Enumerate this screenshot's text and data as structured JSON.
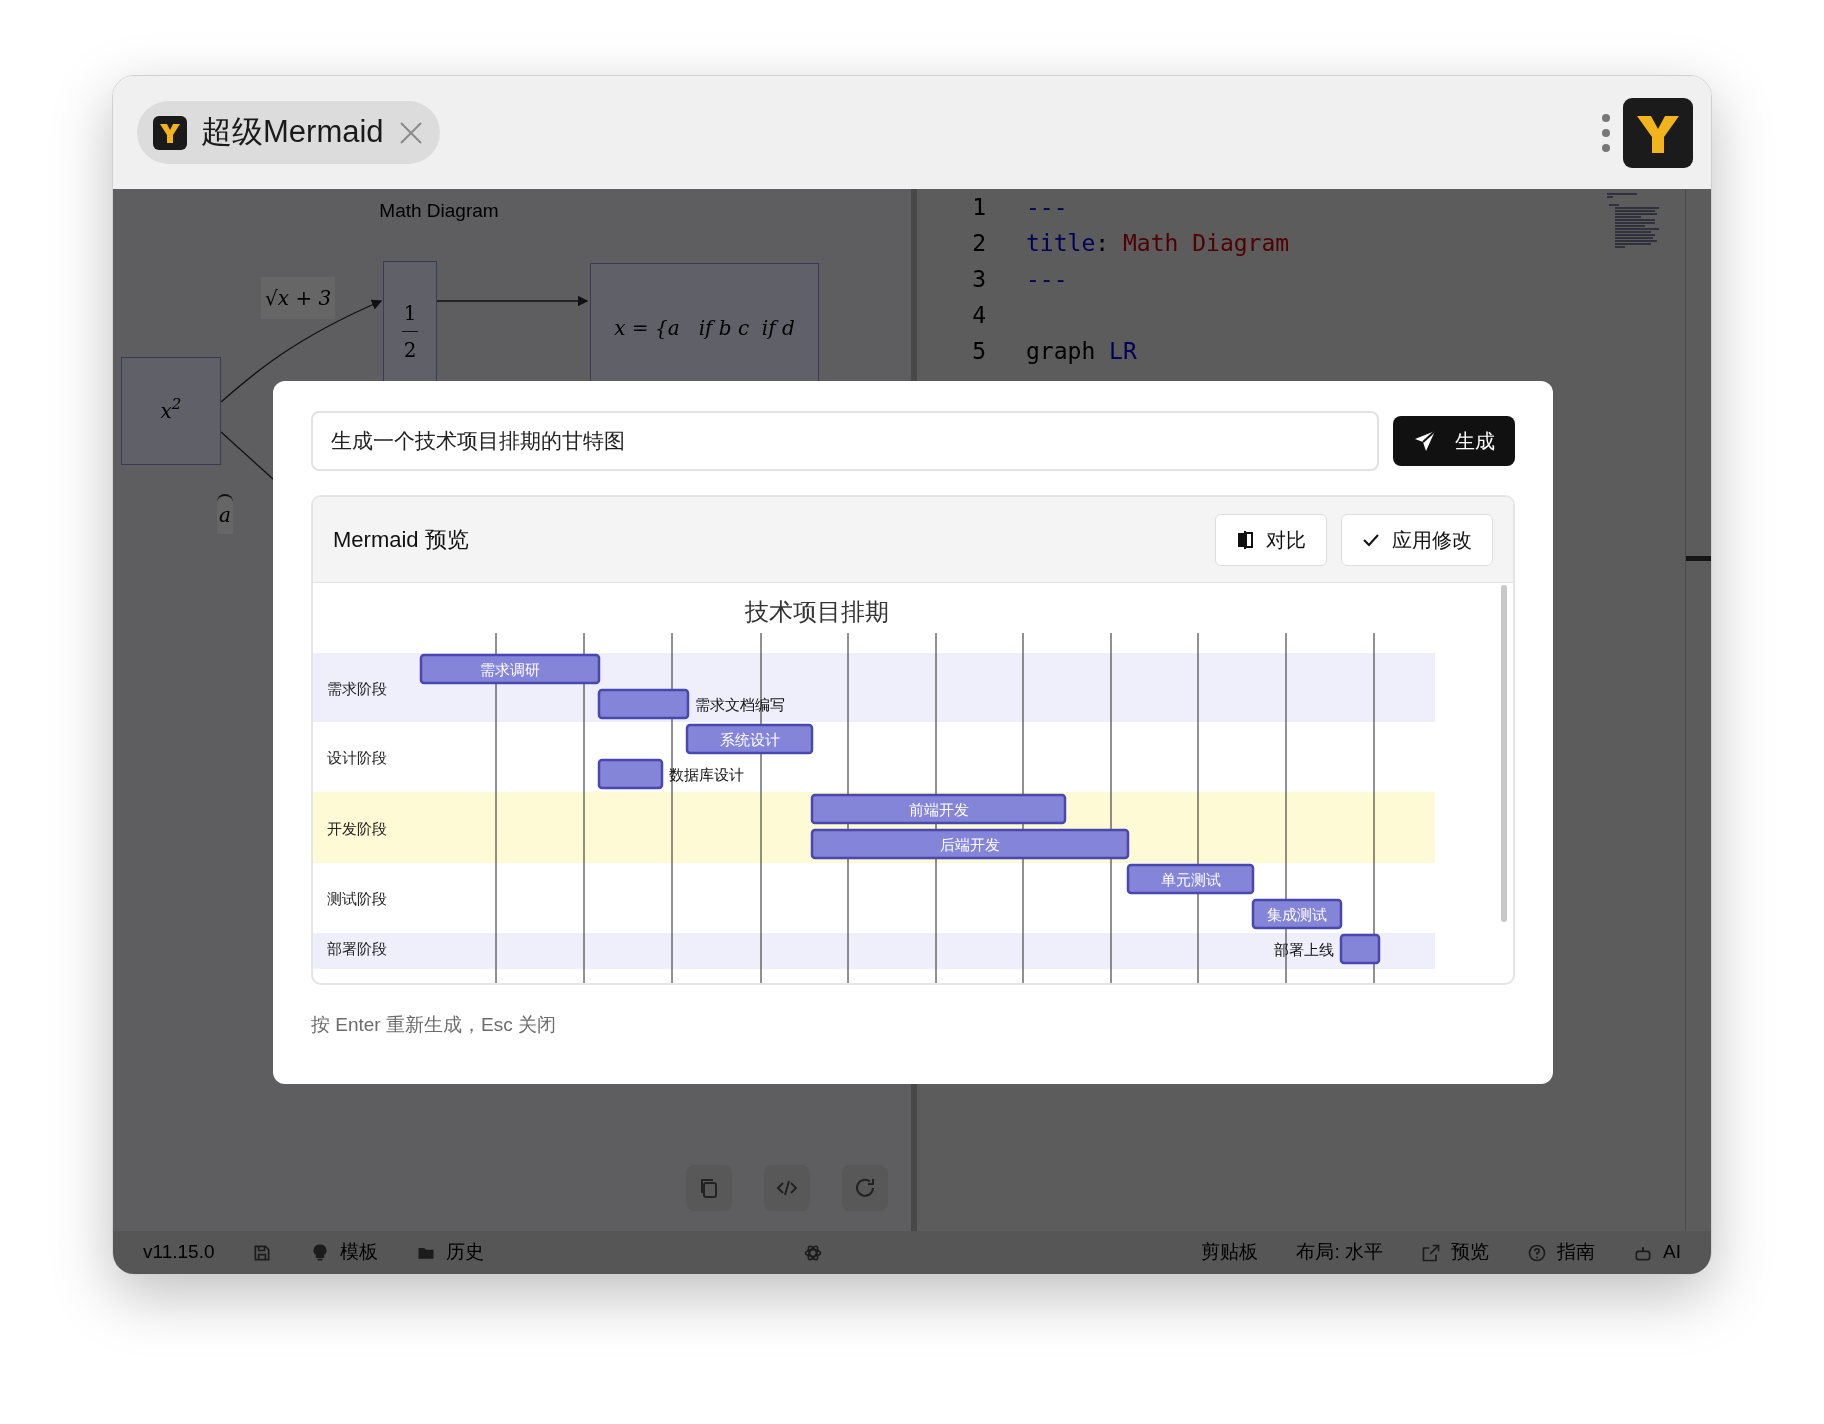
{
  "window": {
    "tab": {
      "title": "超级Mermaid"
    }
  },
  "preview": {
    "diagram_title": "Math Diagram",
    "nodes": [
      {
        "kind": "power",
        "text": "x$^{2}$"
      },
      {
        "kind": "fraction",
        "numerator": "1",
        "denominator": "2"
      },
      {
        "kind": "cases",
        "text": "x = {a   if b c  if d"
      }
    ],
    "edge_labels": [
      {
        "kind": "root",
        "text": "√x + 3"
      },
      {
        "kind": "hat",
        "text": "a"
      }
    ],
    "toolbar": [
      {
        "kind": "copy"
      },
      {
        "kind": "code"
      },
      {
        "kind": "refresh"
      }
    ]
  },
  "editor": {
    "lines": [
      {
        "number": "1",
        "tokens": [
          {
            "kind": "punct",
            "text": "---"
          }
        ]
      },
      {
        "number": "2",
        "tokens": [
          {
            "kind": "key",
            "text": "title"
          },
          {
            "kind": "plain",
            "text": ": "
          },
          {
            "kind": "string",
            "text": "Math Diagram"
          }
        ]
      },
      {
        "number": "3",
        "tokens": [
          {
            "kind": "punct",
            "text": "---"
          }
        ]
      },
      {
        "number": "4"
      },
      {
        "number": "5",
        "tokens": [
          {
            "kind": "plain",
            "text": "graph "
          },
          {
            "kind": "key",
            "text": "LR"
          }
        ]
      }
    ]
  },
  "dialog": {
    "prompt": {
      "value": "生成一个技术项目排期的甘特图"
    },
    "generate_button": "生成",
    "preview_card": {
      "title": "Mermaid 预览",
      "buttons": [
        {
          "kind": "compare",
          "label": "对比"
        },
        {
          "kind": "apply",
          "label": "应用修改"
        }
      ],
      "gantt": {
        "title": "技术项目排期",
        "sections": [
          {
            "name": "需求阶段",
            "color": "#efeffc",
            "tasks": [
              {
                "name": "需求调研",
                "kind": "inside"
              },
              {
                "name": "需求文档编写",
                "kind": "right"
              }
            ]
          },
          {
            "name": "设计阶段",
            "tasks": [
              {
                "name": "系统设计",
                "kind": "inside"
              },
              {
                "name": "数据库设计",
                "kind": "right"
              }
            ]
          },
          {
            "name": "开发阶段",
            "color": "#fffad6",
            "tasks": [
              {
                "name": "前端开发",
                "kind": "inside"
              },
              {
                "name": "后端开发",
                "kind": "inside"
              }
            ]
          },
          {
            "name": "测试阶段",
            "tasks": [
              {
                "name": "单元测试",
                "kind": "inside"
              },
              {
                "name": "集成测试",
                "kind": "inside"
              }
            ]
          },
          {
            "name": "部署阶段",
            "color": "#efeffc",
            "tasks": [
              {
                "name": "部署上线",
                "kind": "left"
              }
            ]
          }
        ]
      }
    },
    "hint": "按 Enter 重新生成，Esc 关闭"
  },
  "status_bar": {
    "version": "v11.15.0",
    "left": [
      {
        "kind": "save"
      },
      {
        "kind": "template",
        "label": "模板"
      },
      {
        "kind": "history",
        "label": "历史"
      }
    ],
    "center": [
      {
        "kind": "assistant"
      }
    ],
    "right": [
      {
        "kind": "clipboard",
        "label": "剪贴板"
      },
      {
        "kind": "layout",
        "label": "布局: 水平"
      },
      {
        "kind": "preview",
        "label": "预览"
      },
      {
        "kind": "guide",
        "label": "指南"
      },
      {
        "kind": "ai",
        "label": "AI"
      }
    ]
  }
}
